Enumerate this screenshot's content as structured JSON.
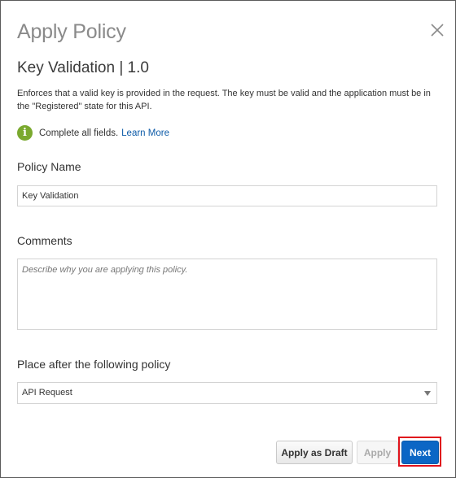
{
  "dialog": {
    "title": "Apply Policy",
    "subtitle": "Key Validation | 1.0",
    "description": "Enforces that a valid key is provided in the request. The key must be valid and the application must be in the \"Registered\" state for this API.",
    "info": {
      "icon": "info-icon",
      "text": "Complete all fields.",
      "link": "Learn More"
    },
    "close_icon": "close-icon"
  },
  "form": {
    "policy_name": {
      "label": "Policy Name",
      "value": "Key Validation"
    },
    "comments": {
      "label": "Comments",
      "placeholder": "Describe why you are applying this policy."
    },
    "place_after": {
      "label": "Place after the following policy",
      "selected": "API Request"
    }
  },
  "buttons": {
    "apply_as_draft": "Apply as Draft",
    "apply": "Apply",
    "next": "Next"
  },
  "colors": {
    "accent": "#0b66c5",
    "info_icon": "#7aa92e",
    "highlight": "#e0131c",
    "link": "#0d5ba8"
  }
}
